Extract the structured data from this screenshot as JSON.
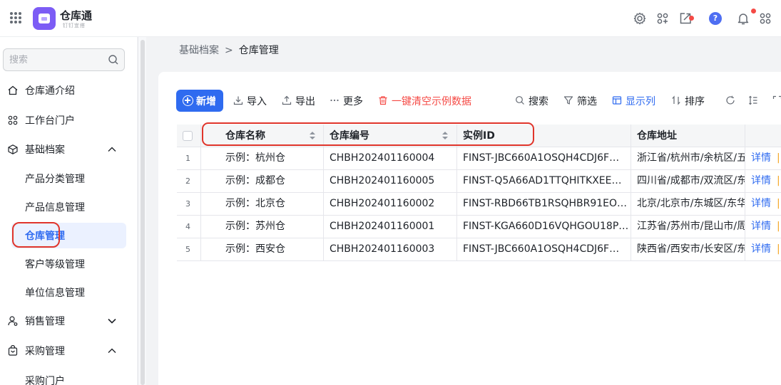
{
  "app": {
    "title": "仓库通",
    "subtitle": "钉钉宜搭"
  },
  "sidebar": {
    "search_placeholder": "搜索",
    "items": [
      {
        "label": "仓库通介绍"
      },
      {
        "label": "工作台门户"
      },
      {
        "label": "基础档案",
        "expanded": true
      },
      {
        "label": "产品分类管理"
      },
      {
        "label": "产品信息管理"
      },
      {
        "label": "仓库管理",
        "active": true
      },
      {
        "label": "客户等级管理"
      },
      {
        "label": "单位信息管理"
      },
      {
        "label": "销售管理",
        "expanded": false
      },
      {
        "label": "采购管理",
        "expanded": true
      },
      {
        "label": "采购门户"
      }
    ]
  },
  "breadcrumb": {
    "parent": "基础档案",
    "current": "仓库管理"
  },
  "toolbar": {
    "add_label": "新增",
    "import_label": "导入",
    "export_label": "导出",
    "more_label": "更多",
    "clear_label": "一键清空示例数据",
    "search_label": "搜索",
    "filter_label": "筛选",
    "columns_label": "显示列",
    "sort_label": "排序"
  },
  "table": {
    "columns": [
      "仓库名称",
      "仓库编号",
      "实例ID",
      "仓库地址"
    ],
    "rows": [
      {
        "index": "1",
        "name": "示例：杭州仓",
        "code": "CHBH202401160004",
        "instance_id": "FINST-JBC660A1OSQH4CDJ6F…",
        "address": "浙江省/杭州市/余杭区/五",
        "action": "详情"
      },
      {
        "index": "2",
        "name": "示例：成都仓",
        "code": "CHBH202401160005",
        "instance_id": "FINST-Q5A66AD1TTQHITKXEE…",
        "address": "四川省/成都市/双流区/东",
        "action": "详情"
      },
      {
        "index": "3",
        "name": "示例：北京仓",
        "code": "CHBH202401160002",
        "instance_id": "FINST-RBD66TB1RSQHBR91EO…",
        "address": "北京/北京市/东城区/东华",
        "action": "详情"
      },
      {
        "index": "4",
        "name": "示例：苏州仓",
        "code": "CHBH202401160001",
        "instance_id": "FINST-KGA660D16VQHGOU18P…",
        "address": "江苏省/苏州市/昆山市/周",
        "action": "详情"
      },
      {
        "index": "5",
        "name": "示例：西安仓",
        "code": "CHBH202401160003",
        "instance_id": "FINST-JBC660A1OSQH4CDJ6F…",
        "address": "陕西省/西安市/长安区/东",
        "action": "详情"
      }
    ]
  },
  "colors": {
    "primary": "#2f6bf0",
    "danger": "#f54a45",
    "annotation": "#e0352b",
    "logo": "#7c5cf5"
  },
  "icons": {
    "header": [
      "settings-icon",
      "apps-add-icon",
      "share-icon",
      "help-icon",
      "bell-icon",
      "more-apps-icon"
    ]
  }
}
